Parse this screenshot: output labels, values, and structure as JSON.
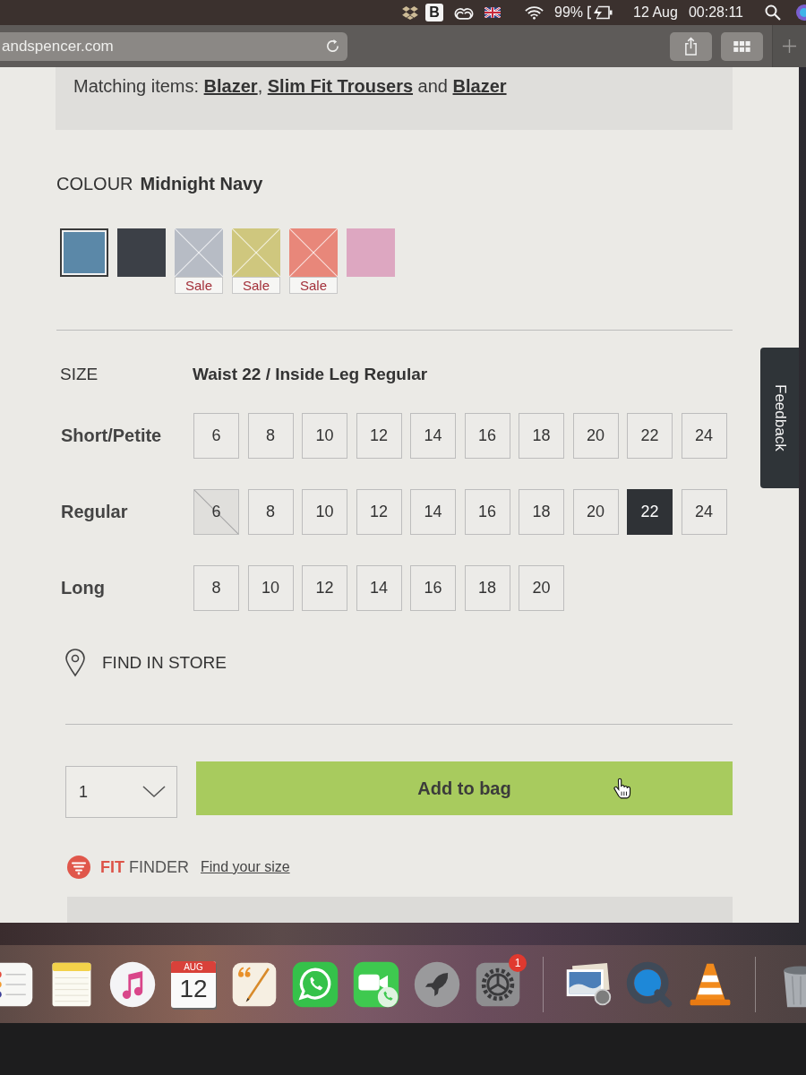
{
  "menu_bar": {
    "app_letter": "B",
    "battery": "99%",
    "date": "12 Aug",
    "time": "00:28:11"
  },
  "browser": {
    "url": "andspencer.com"
  },
  "matching_items": {
    "parts": [
      {
        "kind": "text",
        "text": "Matching items: "
      },
      {
        "kind": "link",
        "text": "Blazer"
      },
      {
        "kind": "text",
        "text": ", "
      },
      {
        "kind": "link",
        "text": "Slim Fit Trousers"
      },
      {
        "kind": "text",
        "text": " and "
      },
      {
        "kind": "link",
        "text": "Blazer"
      }
    ]
  },
  "colour": {
    "label": "COLOUR",
    "value": "Midnight Navy",
    "swatches": [
      {
        "color": "#5b88a8",
        "selected": true,
        "unavailable": false
      },
      {
        "color": "#3c4047",
        "selected": false,
        "unavailable": false
      },
      {
        "color": "#b7bcc5",
        "selected": false,
        "unavailable": true,
        "badge": "Sale"
      },
      {
        "color": "#cfc77e",
        "selected": false,
        "unavailable": true,
        "badge": "Sale"
      },
      {
        "color": "#e8877a",
        "selected": false,
        "unavailable": true,
        "badge": "Sale"
      },
      {
        "color": "#dda7c1",
        "selected": false,
        "unavailable": false
      }
    ]
  },
  "size": {
    "label": "SIZE",
    "selection": "Waist 22 / Inside Leg Regular",
    "rows": [
      {
        "label": "Short/Petite",
        "sizes": [
          {
            "label": "6",
            "selected": false,
            "unavailable": false
          },
          {
            "label": "8",
            "selected": false,
            "unavailable": false
          },
          {
            "label": "10",
            "selected": false,
            "unavailable": false
          },
          {
            "label": "12",
            "selected": false,
            "unavailable": false
          },
          {
            "label": "14",
            "selected": false,
            "unavailable": false
          },
          {
            "label": "16",
            "selected": false,
            "unavailable": false
          },
          {
            "label": "18",
            "selected": false,
            "unavailable": false
          },
          {
            "label": "20",
            "selected": false,
            "unavailable": false
          },
          {
            "label": "22",
            "selected": false,
            "unavailable": false
          },
          {
            "label": "24",
            "selected": false,
            "unavailable": false
          }
        ]
      },
      {
        "label": "Regular",
        "sizes": [
          {
            "label": "6",
            "selected": false,
            "unavailable": true
          },
          {
            "label": "8",
            "selected": false,
            "unavailable": false
          },
          {
            "label": "10",
            "selected": false,
            "unavailable": false
          },
          {
            "label": "12",
            "selected": false,
            "unavailable": false
          },
          {
            "label": "14",
            "selected": false,
            "unavailable": false
          },
          {
            "label": "16",
            "selected": false,
            "unavailable": false
          },
          {
            "label": "18",
            "selected": false,
            "unavailable": false
          },
          {
            "label": "20",
            "selected": false,
            "unavailable": false
          },
          {
            "label": "22",
            "selected": true,
            "unavailable": false
          },
          {
            "label": "24",
            "selected": false,
            "unavailable": false
          }
        ]
      },
      {
        "label": "Long",
        "sizes": [
          {
            "label": "8",
            "selected": false,
            "unavailable": false
          },
          {
            "label": "10",
            "selected": false,
            "unavailable": false
          },
          {
            "label": "12",
            "selected": false,
            "unavailable": false
          },
          {
            "label": "14",
            "selected": false,
            "unavailable": false
          },
          {
            "label": "16",
            "selected": false,
            "unavailable": false
          },
          {
            "label": "18",
            "selected": false,
            "unavailable": false
          },
          {
            "label": "20",
            "selected": false,
            "unavailable": false
          }
        ]
      }
    ]
  },
  "find_in_store": "FIND IN STORE",
  "quantity": "1",
  "add_to_bag": "Add to bag",
  "fit_finder": {
    "brand_bold": "FIT",
    "brand": "FINDER",
    "link": "Find your size"
  },
  "feedback": "Feedback",
  "dock": [
    {
      "kind": "list"
    },
    {
      "kind": "notepad"
    },
    {
      "kind": "music"
    },
    {
      "kind": "calendar",
      "month": "AUG",
      "day": "12"
    },
    {
      "kind": "pen"
    },
    {
      "kind": "chat"
    },
    {
      "kind": "video"
    },
    {
      "kind": "rocket"
    },
    {
      "kind": "gear",
      "badge": "1"
    },
    {
      "kind": "separator"
    },
    {
      "kind": "photos"
    },
    {
      "kind": "ring"
    },
    {
      "kind": "cone"
    },
    {
      "kind": "separator"
    },
    {
      "kind": "trash"
    }
  ]
}
